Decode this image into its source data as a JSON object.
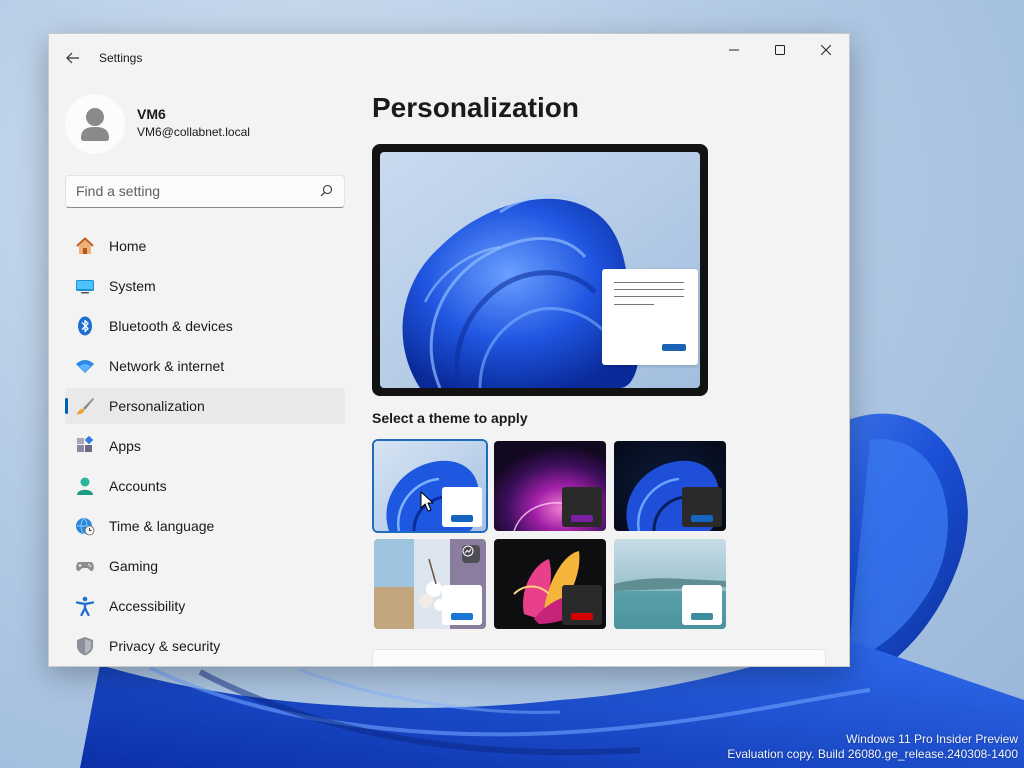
{
  "window": {
    "title": "Settings",
    "controls": {
      "minimize": "minimize-icon",
      "maximize": "maximize-icon",
      "close": "close-icon"
    }
  },
  "user": {
    "name": "VM6",
    "email": "VM6@collabnet.local"
  },
  "search": {
    "placeholder": "Find a setting"
  },
  "nav": {
    "items": [
      {
        "label": "Home",
        "icon": "home-icon",
        "selected": false
      },
      {
        "label": "System",
        "icon": "system-icon",
        "selected": false
      },
      {
        "label": "Bluetooth & devices",
        "icon": "bluetooth-icon",
        "selected": false
      },
      {
        "label": "Network & internet",
        "icon": "network-icon",
        "selected": false
      },
      {
        "label": "Personalization",
        "icon": "brush-icon",
        "selected": true
      },
      {
        "label": "Apps",
        "icon": "apps-icon",
        "selected": false
      },
      {
        "label": "Accounts",
        "icon": "accounts-icon",
        "selected": false
      },
      {
        "label": "Time & language",
        "icon": "globe-clock-icon",
        "selected": false
      },
      {
        "label": "Gaming",
        "icon": "gamepad-icon",
        "selected": false
      },
      {
        "label": "Accessibility",
        "icon": "accessibility-icon",
        "selected": false
      },
      {
        "label": "Privacy & security",
        "icon": "shield-icon",
        "selected": false
      }
    ]
  },
  "main": {
    "title": "Personalization",
    "themes_label": "Select a theme to apply",
    "themes": [
      {
        "name": "windows-light",
        "selected": true,
        "accent": "#1565c0"
      },
      {
        "name": "windows-dark-glow",
        "selected": false,
        "accent": "#7b1fa2"
      },
      {
        "name": "windows-dark",
        "selected": false,
        "accent": "#1565c0"
      },
      {
        "name": "windows-spotlight",
        "selected": false,
        "accent": "#1976d2"
      },
      {
        "name": "captured-motion",
        "selected": false,
        "accent": "#d50000"
      },
      {
        "name": "flow",
        "selected": false,
        "accent": "#3d8fa0"
      }
    ]
  },
  "watermark": {
    "line1": "Windows 11 Pro Insider Preview",
    "line2": "Evaluation copy. Build 26080.ge_release.240308-1400"
  },
  "colors": {
    "accent": "#005fb8",
    "window_bg": "#f3f3f3",
    "bloom_blue": "#1a4fd6"
  }
}
